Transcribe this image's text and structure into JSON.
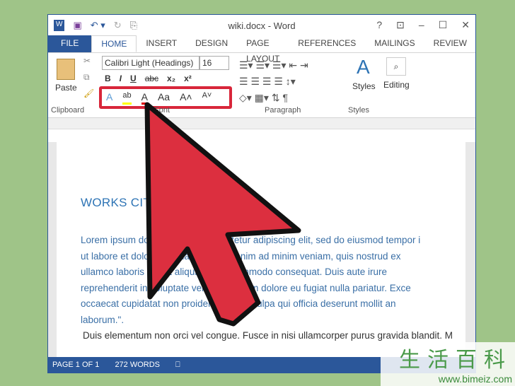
{
  "window": {
    "title": "wiki.docx - Word",
    "controls": [
      "?",
      "⊡",
      "–",
      "☐",
      "✕"
    ]
  },
  "tabs": [
    "FILE",
    "HOME",
    "INSERT",
    "DESIGN",
    "PAGE LAYOUT",
    "REFERENCES",
    "MAILINGS",
    "REVIEW"
  ],
  "ribbon": {
    "font_name": "Calibri Light (Headings)",
    "font_size": "16",
    "paste": "Paste",
    "styles": "Styles",
    "editing": "Editing",
    "groups": {
      "clipboard": "Clipboard",
      "font": "Font",
      "paragraph": "Paragraph",
      "styles": "Styles"
    },
    "font_buttons": [
      "B",
      "I",
      "U",
      "abc",
      "x₂",
      "x²"
    ],
    "font_row2": [
      "A",
      "ab",
      "A",
      "Aa",
      "A˄",
      "A˅"
    ]
  },
  "document": {
    "heading": "WORKS CITED",
    "lines": [
      "Lorem ipsum dolor sit amet, consectetur adipiscing elit, sed do eiusmod tempor i",
      "ut labore et dolore magna aliqua. Ut enim ad minim veniam, quis nostrud ex",
      "ullamco laboris nisi ut aliquip ex ea commodo consequat. Duis aute irure",
      "reprehenderit in voluptate velit esse cillum dolore eu fugiat nulla pariatur. Exce",
      "occaecat cupidatat non proident, sunt in culpa qui officia deserunt mollit an",
      "laborum.\"."
    ],
    "line2": "Duis elementum non orci vel congue. Fusce in nisi ullamcorper purus gravida blandit. M"
  },
  "status": {
    "page": "PAGE 1 OF 1",
    "words": "272 WORDS"
  },
  "watermark": {
    "chars": "生活百科",
    "url": "www.bimeiz.com"
  },
  "colors": {
    "accent": "#2b579a",
    "highlight": "#d8263a",
    "arrow": "#dc2f3f",
    "background": "#9fc488"
  }
}
